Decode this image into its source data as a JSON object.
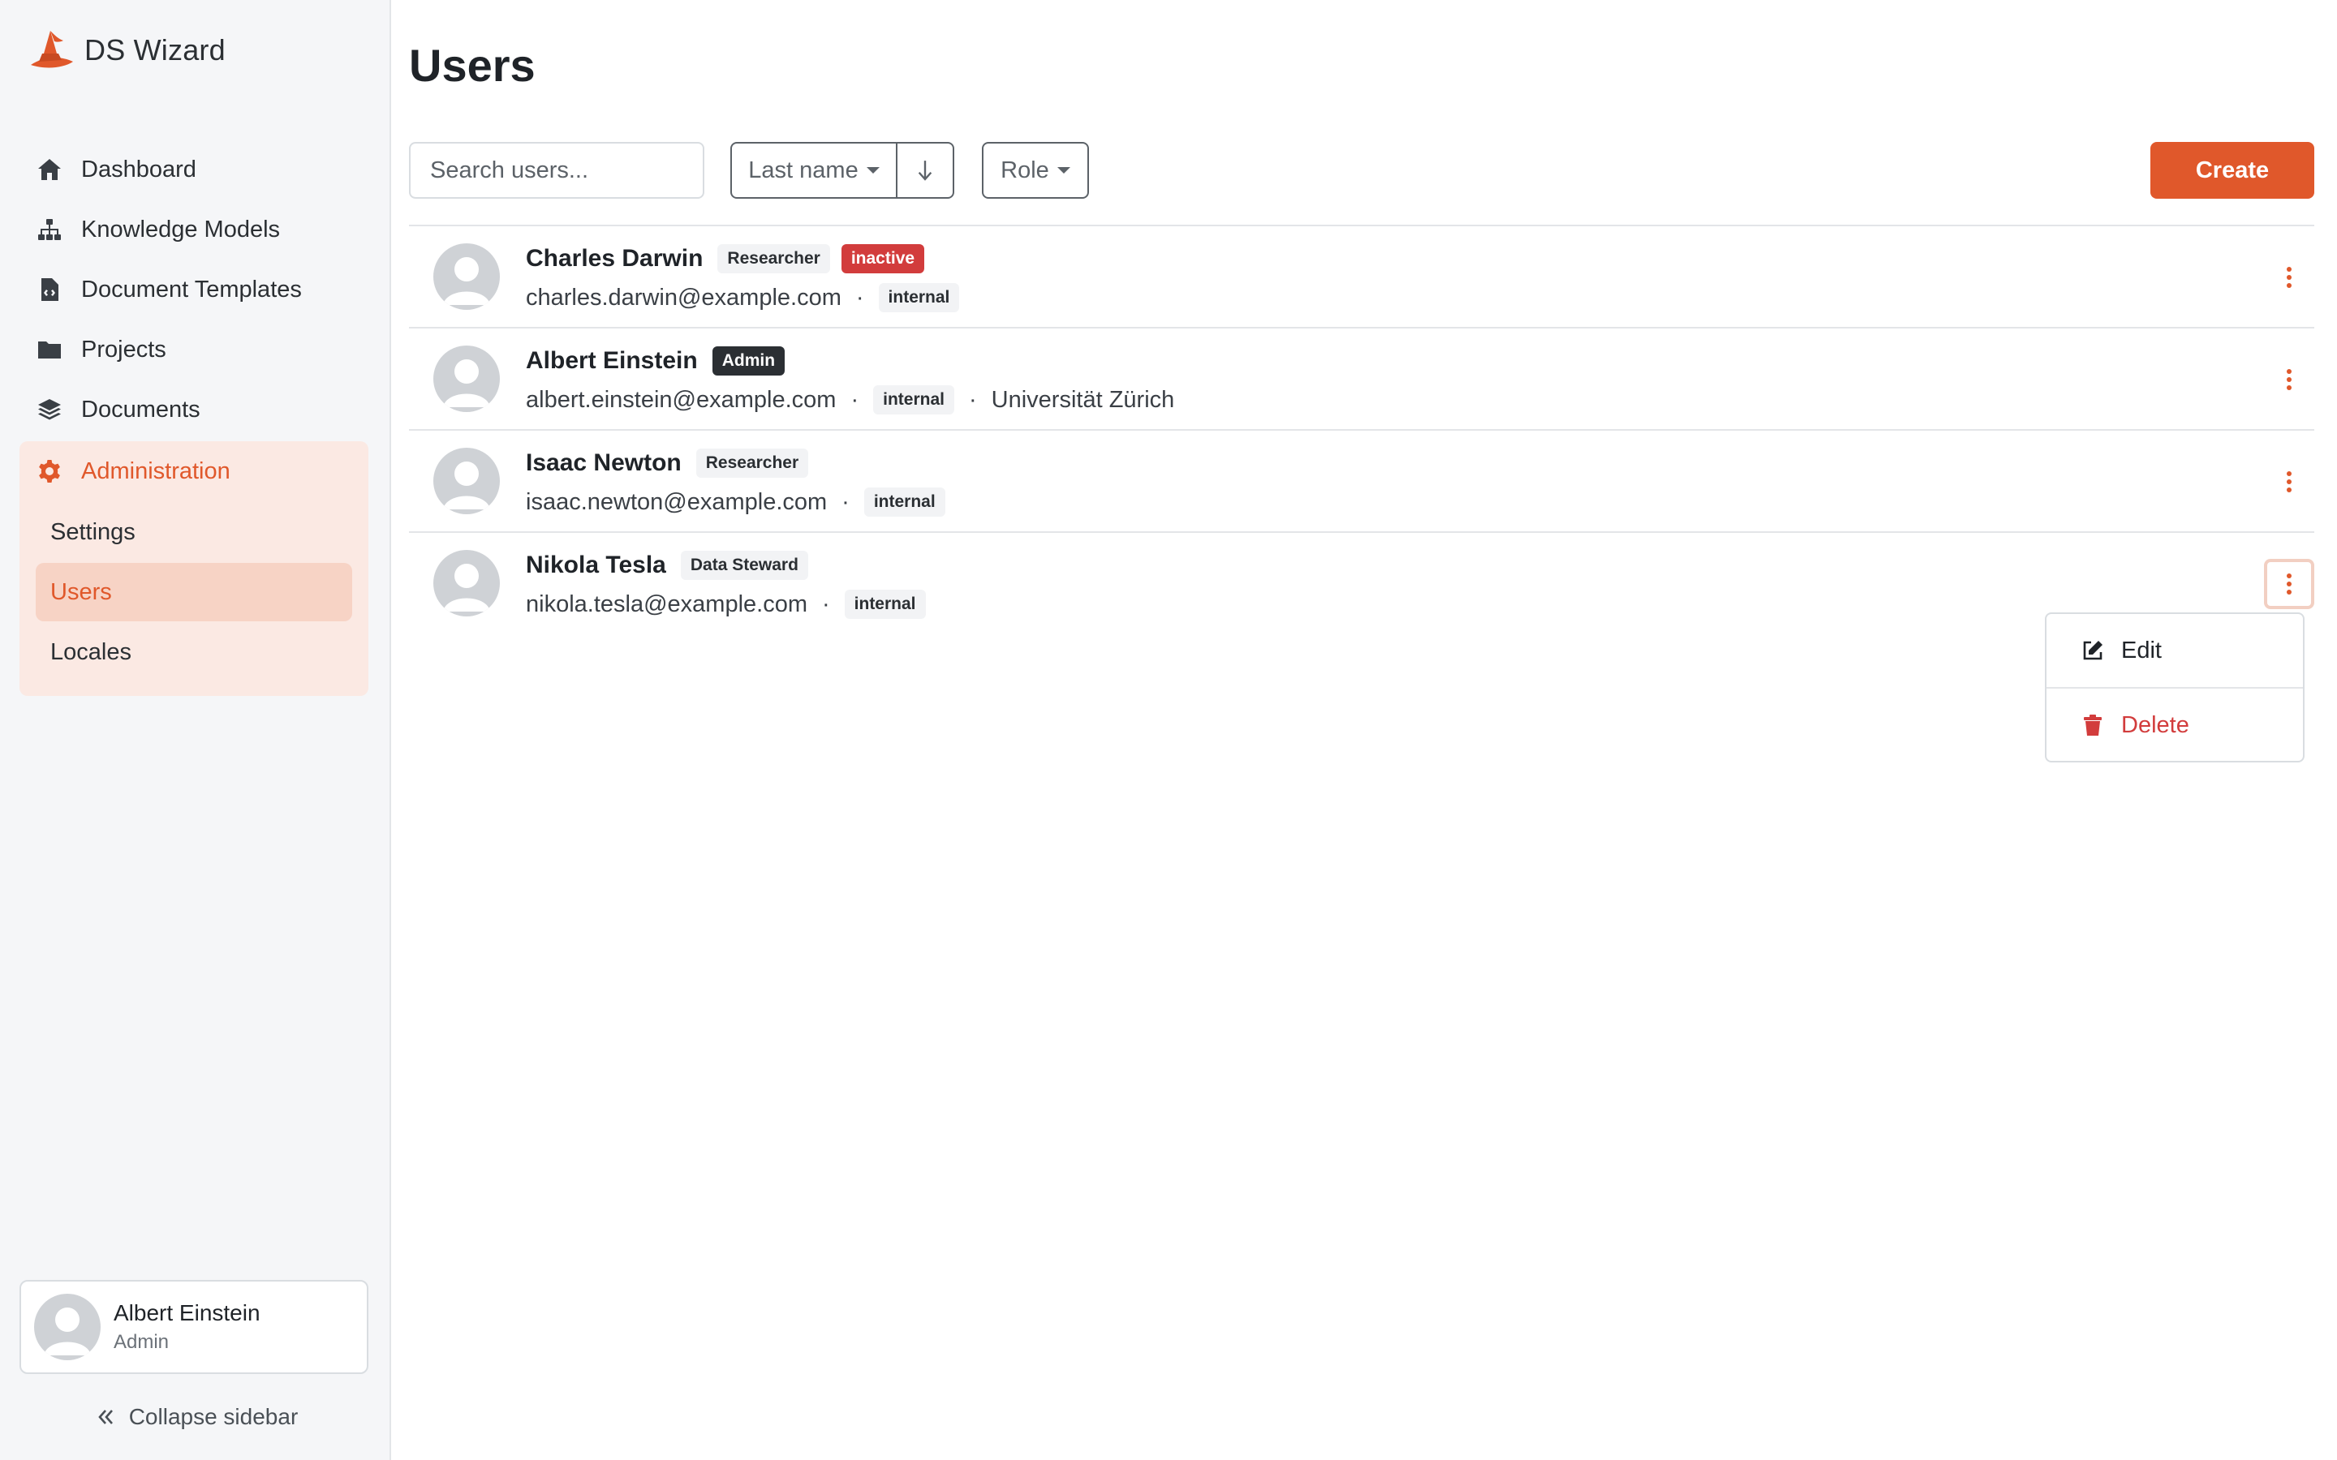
{
  "app": {
    "name": "DS Wizard"
  },
  "sidebar": {
    "items": [
      {
        "label": "Dashboard",
        "icon": "home-icon"
      },
      {
        "label": "Knowledge Models",
        "icon": "sitemap-icon"
      },
      {
        "label": "Document Templates",
        "icon": "file-code-icon"
      },
      {
        "label": "Projects",
        "icon": "folder-icon"
      },
      {
        "label": "Documents",
        "icon": "layers-icon"
      }
    ],
    "admin": {
      "label": "Administration",
      "icon": "gear-icon",
      "children": [
        {
          "label": "Settings"
        },
        {
          "label": "Users",
          "active": true
        },
        {
          "label": "Locales"
        }
      ]
    },
    "profile": {
      "name": "Albert Einstein",
      "role": "Admin"
    },
    "collapse_label": "Collapse sidebar"
  },
  "page": {
    "title": "Users"
  },
  "toolbar": {
    "search_placeholder": "Search users...",
    "sort_label": "Last name",
    "sort_direction_icon": "arrow-down-icon",
    "role_filter_label": "Role",
    "create_label": "Create"
  },
  "users": [
    {
      "name": "Charles Darwin",
      "role": "Researcher",
      "status": "inactive",
      "email": "charles.darwin@example.com",
      "source": "internal",
      "affiliation": ""
    },
    {
      "name": "Albert Einstein",
      "role": "Admin",
      "status": "",
      "email": "albert.einstein@example.com",
      "source": "internal",
      "affiliation": "Universität Zürich"
    },
    {
      "name": "Isaac Newton",
      "role": "Researcher",
      "status": "",
      "email": "isaac.newton@example.com",
      "source": "internal",
      "affiliation": ""
    },
    {
      "name": "Nikola Tesla",
      "role": "Data Steward",
      "status": "",
      "email": "nikola.tesla@example.com",
      "source": "internal",
      "affiliation": ""
    }
  ],
  "row_menu": {
    "open_for": "Nikola Tesla",
    "items": [
      {
        "label": "Edit",
        "icon": "edit-icon"
      },
      {
        "label": "Delete",
        "icon": "trash-icon"
      }
    ]
  },
  "colors": {
    "accent": "#e0582b",
    "danger": "#d23c3c",
    "dark_badge": "#2b2f33"
  },
  "separator": "·"
}
